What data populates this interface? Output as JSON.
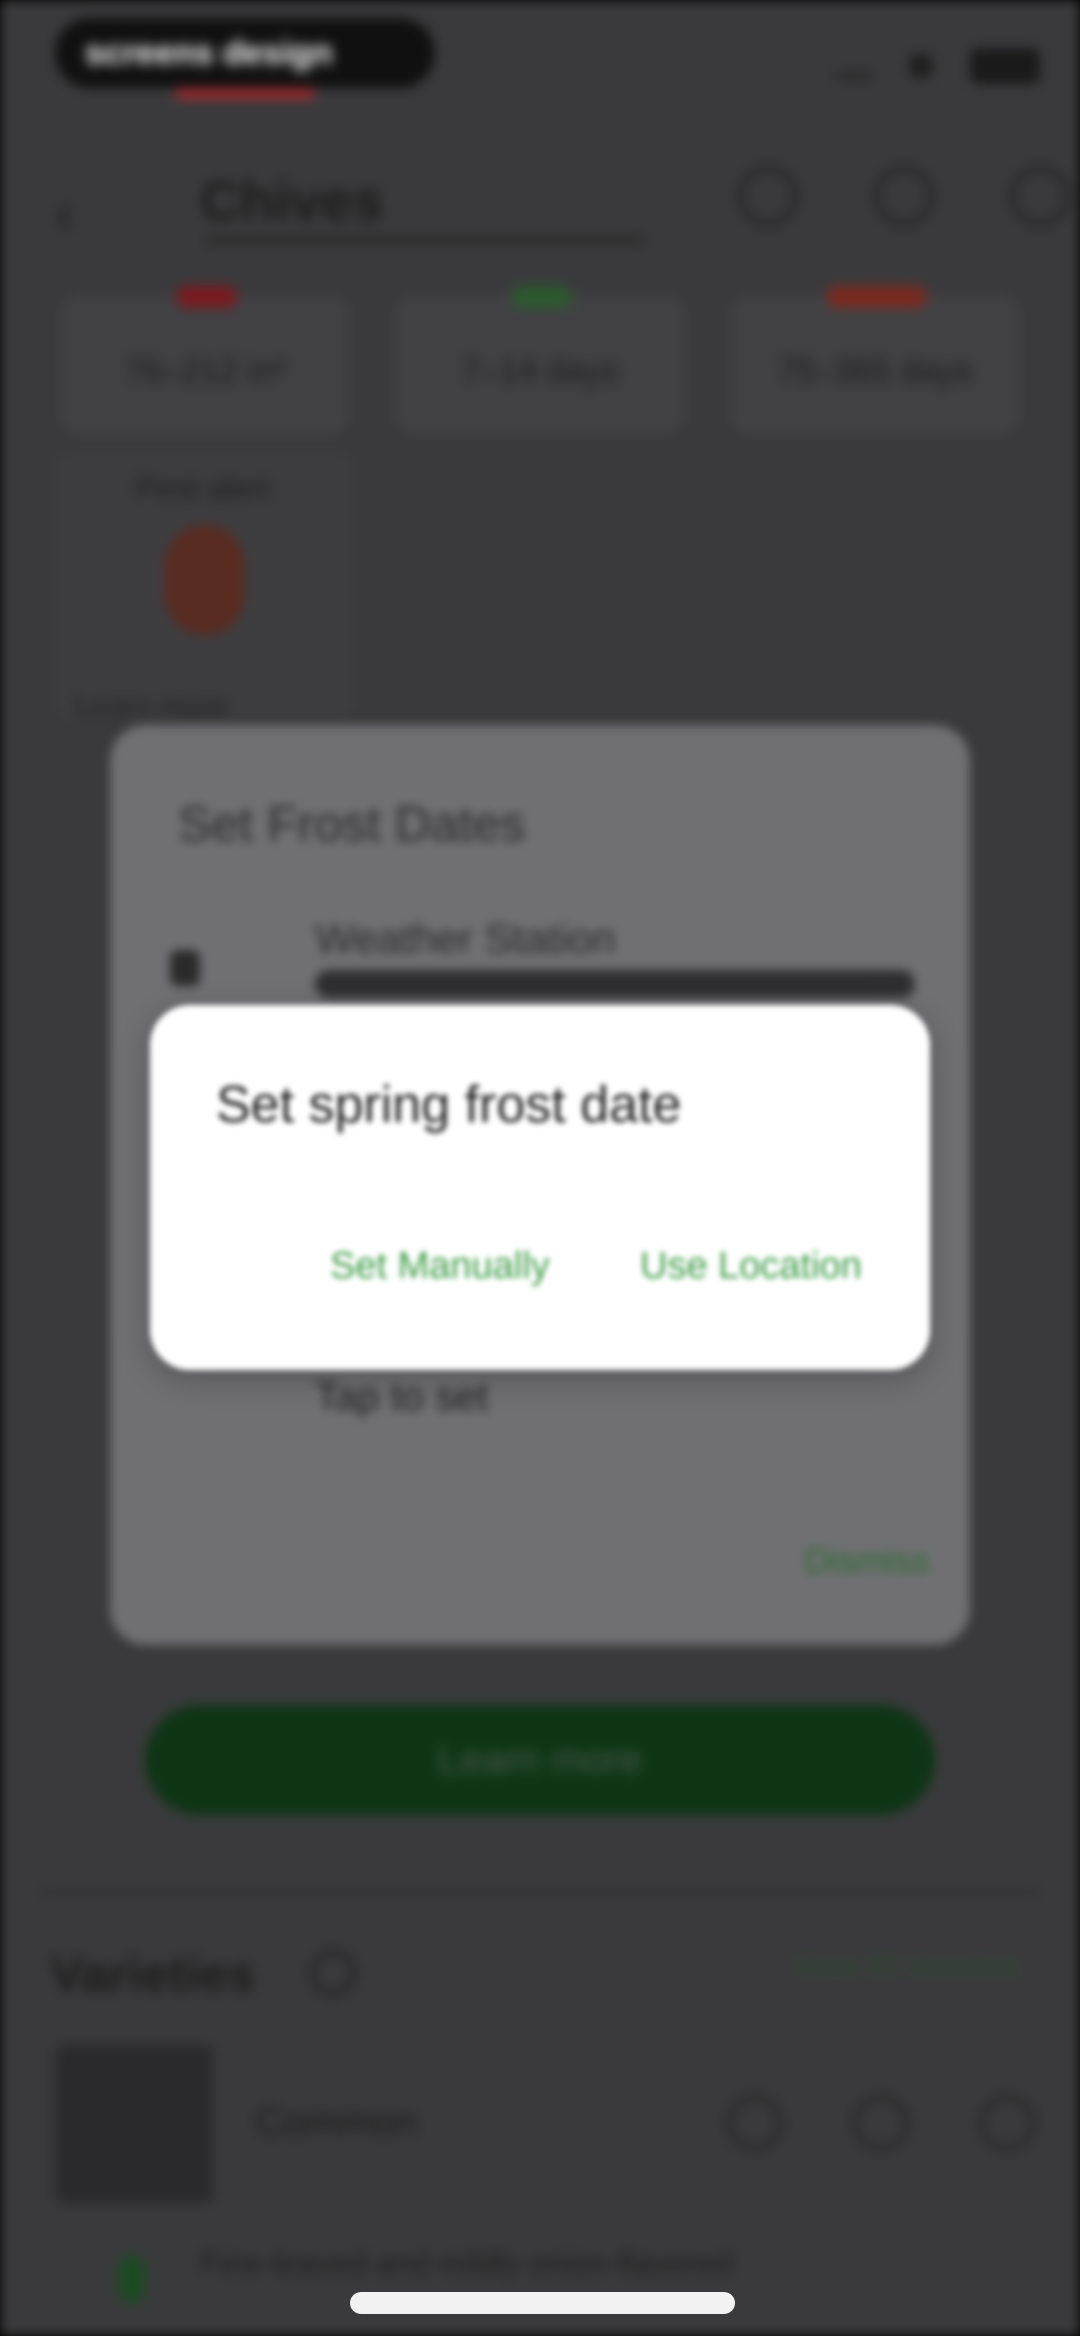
{
  "status_bar": {
    "brand": "screens design"
  },
  "header": {
    "title": "Chives",
    "icons": [
      "back-icon",
      "share-icon",
      "favorite-icon",
      "edit-icon"
    ]
  },
  "stats": [
    {
      "value": "76–212 in²",
      "color": "#c2262d"
    },
    {
      "value": "7–14 days",
      "color": "#3c8b3f"
    },
    {
      "value": "75–365 days",
      "color": "#c2262d"
    }
  ],
  "pest_card": {
    "label": "Pest alert",
    "caption": "Learn more"
  },
  "dialog_frost": {
    "title": "Set Frost Dates",
    "option_title": "Weather Station",
    "tap_to_set": "Tap to set",
    "dismiss": "Dismiss"
  },
  "dialog_spring": {
    "title": "Set spring frost date",
    "btn_manual": "Set Manually",
    "btn_location": "Use Location"
  },
  "learn_button": "Learn more",
  "varieties": {
    "title": "Varieties",
    "view_all": "View All Varieties",
    "items": [
      {
        "name": "Common"
      }
    ],
    "description": "Fine-leaved and mildly onion-flavored"
  },
  "colors": {
    "accent": "#3c9b45",
    "dialog": "#ffffff"
  }
}
